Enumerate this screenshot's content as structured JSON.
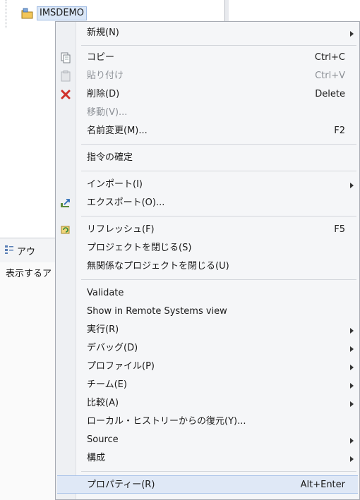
{
  "project_tree": {
    "item_label": "IMSDEMO",
    "icon": "project-folder-icon"
  },
  "outline": {
    "tab_label": "アウ",
    "message": "表示するア",
    "icon": "outline-icon"
  },
  "context_menu": {
    "items": [
      {
        "label": "新規(N)",
        "submenu": true
      },
      {
        "label": "コピー",
        "accel": "Ctrl+C",
        "icon": "copy-icon"
      },
      {
        "label": "貼り付け",
        "accel": "Ctrl+V",
        "icon": "paste-icon",
        "disabled": true
      },
      {
        "label": "削除(D)",
        "accel": "Delete",
        "icon": "delete-icon"
      },
      {
        "label": "移動(V)...",
        "disabled": true
      },
      {
        "label": "名前変更(M)...",
        "accel": "F2"
      },
      {
        "label": "指令の確定"
      },
      {
        "label": "インポート(I)",
        "submenu": true
      },
      {
        "label": "エクスポート(O)...",
        "icon": "export-icon"
      },
      {
        "label": "リフレッシュ(F)",
        "accel": "F5",
        "icon": "refresh-icon"
      },
      {
        "label": "プロジェクトを閉じる(S)"
      },
      {
        "label": "無関係なプロジェクトを閉じる(U)"
      },
      {
        "label": "Validate"
      },
      {
        "label": "Show in Remote Systems view"
      },
      {
        "label": "実行(R)",
        "submenu": true
      },
      {
        "label": "デバッグ(D)",
        "submenu": true
      },
      {
        "label": "プロファイル(P)",
        "submenu": true
      },
      {
        "label": "チーム(E)",
        "submenu": true
      },
      {
        "label": "比較(A)",
        "submenu": true
      },
      {
        "label": "ローカル・ヒストリーからの復元(Y)..."
      },
      {
        "label": "Source",
        "submenu": true
      },
      {
        "label": "構成",
        "submenu": true
      },
      {
        "label": "プロパティー(R)",
        "accel": "Alt+Enter",
        "highlighted": true
      }
    ]
  },
  "colors": {
    "menu_bg": "#f5f6f8",
    "highlight": "#dfe8f6",
    "delete_icon": "#d0322b"
  }
}
